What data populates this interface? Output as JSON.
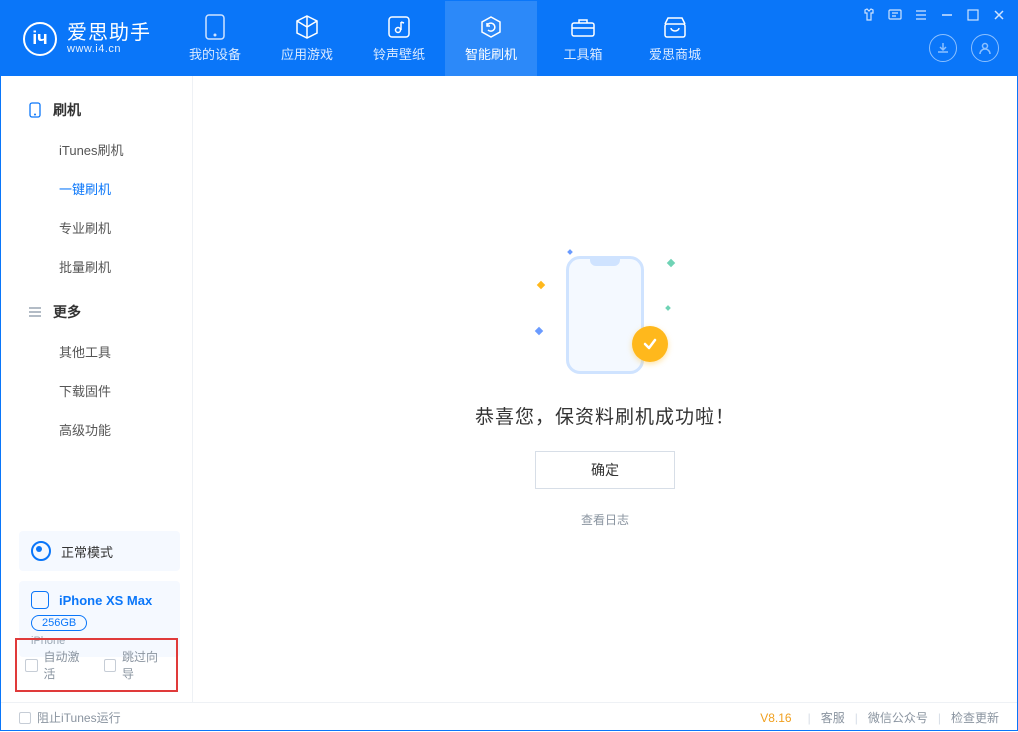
{
  "app": {
    "name": "爱思助手",
    "url": "www.i4.cn"
  },
  "nav": {
    "tabs": [
      {
        "label": "我的设备",
        "icon": "device"
      },
      {
        "label": "应用游戏",
        "icon": "cube"
      },
      {
        "label": "铃声壁纸",
        "icon": "music"
      },
      {
        "label": "智能刷机",
        "icon": "refresh"
      },
      {
        "label": "工具箱",
        "icon": "toolbox"
      },
      {
        "label": "爱思商城",
        "icon": "store"
      }
    ],
    "active_index": 3
  },
  "sidebar": {
    "groups": [
      {
        "title": "刷机",
        "icon": "phone",
        "items": [
          {
            "label": "iTunes刷机"
          },
          {
            "label": "一键刷机",
            "active": true
          },
          {
            "label": "专业刷机"
          },
          {
            "label": "批量刷机"
          }
        ]
      },
      {
        "title": "更多",
        "icon": "list",
        "items": [
          {
            "label": "其他工具"
          },
          {
            "label": "下载固件"
          },
          {
            "label": "高级功能"
          }
        ]
      }
    ],
    "status": {
      "mode": "正常模式"
    },
    "device": {
      "name": "iPhone XS Max",
      "capacity": "256GB",
      "type": "iPhone"
    },
    "options": {
      "auto_activate": "自动激活",
      "skip_guide": "跳过向导"
    }
  },
  "main": {
    "success_text": "恭喜您，保资料刷机成功啦！",
    "confirm_label": "确定",
    "log_link": "查看日志"
  },
  "footer": {
    "block_itunes": "阻止iTunes运行",
    "version": "V8.16",
    "links": {
      "service": "客服",
      "wechat": "微信公众号",
      "update": "检查更新"
    }
  }
}
